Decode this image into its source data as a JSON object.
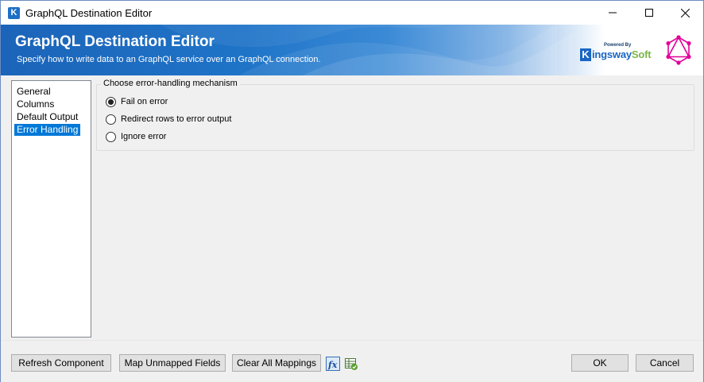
{
  "window": {
    "title": "GraphQL Destination Editor",
    "app_icon_letter": "K"
  },
  "banner": {
    "title": "GraphQL Destination Editor",
    "subtitle": "Specify how to write data to an GraphQL service over an GraphQL connection.",
    "logo": {
      "powered_by": "Powered By",
      "brand_prefix": "K",
      "brand_main": "ingsway",
      "brand_suffix": "Soft"
    }
  },
  "nav": {
    "items": [
      {
        "label": "General",
        "selected": false
      },
      {
        "label": "Columns",
        "selected": false
      },
      {
        "label": "Default Output",
        "selected": false
      },
      {
        "label": "Error Handling",
        "selected": true
      }
    ]
  },
  "error_handling": {
    "group_label": "Choose error-handling mechanism",
    "options": [
      {
        "label": "Fail on error",
        "checked": true
      },
      {
        "label": "Redirect rows to error output",
        "checked": false
      },
      {
        "label": "Ignore error",
        "checked": false
      }
    ]
  },
  "footer": {
    "refresh_label": "Refresh Component",
    "map_label": "Map Unmapped Fields",
    "clear_label": "Clear All Mappings",
    "ok_label": "OK",
    "cancel_label": "Cancel"
  },
  "colors": {
    "accent": "#0078d7",
    "banner_blue": "#1b64b9",
    "graphql_pink": "#e10098"
  }
}
